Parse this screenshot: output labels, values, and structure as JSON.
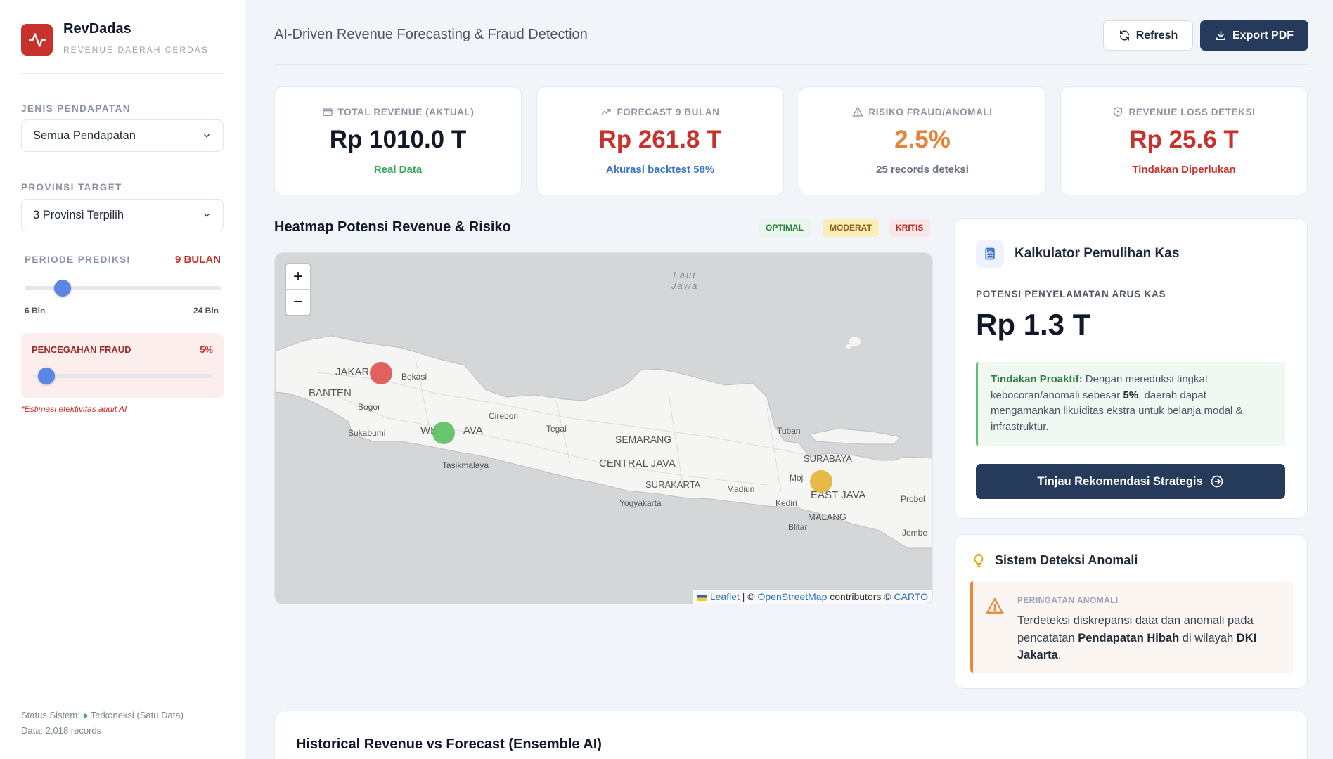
{
  "brand": {
    "title": "RevDadas",
    "subtitle": "REVENUE DAERAH CERDAS"
  },
  "sidebar": {
    "jenis_label": "JENIS PENDAPATAN",
    "jenis_value": "Semua Pendapatan",
    "provinsi_label": "PROVINSI TARGET",
    "provinsi_value": "3 Provinsi Terpilih",
    "periode_label": "PERIODE PREDIKSI",
    "periode_value": "9 BULAN",
    "periode_value_num": 9,
    "periode_min_label": "6 Bln",
    "periode_max_label": "24 Bln",
    "fraud_label": "PENCEGAHAN FRAUD",
    "fraud_value": "5%",
    "fraud_level": 0.05,
    "fraud_note": "*Estimasi efektivitas audit AI",
    "status_prefix": "Status Sistem:",
    "status_text": "Terkoneksi (Satu Data)",
    "data_text": "Data: 2,018 records"
  },
  "header": {
    "title": "AI-Driven Revenue Forecasting & Fraud Detection",
    "refresh_label": "Refresh",
    "export_label": "Export PDF"
  },
  "kpis": [
    {
      "label": "TOTAL REVENUE (AKTUAL)",
      "value": "Rp 1010.0 T",
      "note": "Real Data",
      "icon": "wallet-icon"
    },
    {
      "label": "FORECAST 9 BULAN",
      "value": "Rp 261.8 T",
      "note": "Akurasi backtest 58%",
      "icon": "trending-up-icon"
    },
    {
      "label": "RISIKO FRAUD/ANOMALI",
      "value": "2.5%",
      "note": "25 records deteksi",
      "icon": "warning-icon"
    },
    {
      "label": "REVENUE LOSS DETEKSI",
      "value": "Rp 25.6 T",
      "note": "Tindakan Diperlukan",
      "icon": "shield-icon"
    }
  ],
  "map": {
    "title": "Heatmap Potensi Revenue & Risiko",
    "legend": [
      "OPTIMAL",
      "MODERAT",
      "KRITIS"
    ],
    "labels": {
      "laut": "Laut",
      "jawa": "Jawa",
      "jakarta": "JAKAR",
      "bekasi": "Bekasi",
      "banten": "BANTEN",
      "bogor": "Bogor",
      "sukabumi": "Sukabumi",
      "west_java_a": "WE",
      "west_java_b": "AVA",
      "cirebon": "Cirebon",
      "tegal": "Tegal",
      "tasikmalaya": "Tasikmalaya",
      "semarang": "SEMARANG",
      "central_java": "CENTRAL JAVA",
      "surakarta": "SURAKARTA",
      "yogyakarta": "Yogyakarta",
      "madiun": "Madiun",
      "tuban": "Tuban",
      "surabaya": "SURABAYA",
      "mojo": "Moj",
      "east_java": "EAST JAVA",
      "kediri": "Kediri",
      "malang": "MALANG",
      "blitar": "Blitar",
      "probolinggo": "Probol",
      "jember": "Jembe"
    },
    "zoom_in": "+",
    "zoom_out": "−",
    "attribution": {
      "leaflet": "Leaflet",
      "sep1": " | © ",
      "osm": "OpenStreetMap",
      "contrib": " contributors © ",
      "carto": "CARTO"
    },
    "colors": {
      "kritis": "#e05252",
      "optimal": "#5cbf62",
      "moderat": "#e6b33a"
    }
  },
  "calculator": {
    "title": "Kalkulator Pemulihan Kas",
    "label": "POTENSI PENYELAMATAN ARUS KAS",
    "value": "Rp 1.3 T",
    "proaktif_title": "Tindakan Proaktif:",
    "proaktif_text1": " Dengan mereduksi tingkat kebocoran/anomali sebesar ",
    "proaktif_bold": "5%",
    "proaktif_text2": ", daerah dapat mengamankan likuiditas ekstra untuk belanja modal & infrastruktur.",
    "button_label": "Tinjau Rekomendasi Strategis"
  },
  "anomali": {
    "title": "Sistem Deteksi Anomali",
    "label": "PERINGATAN ANOMALI",
    "text1": "Terdeteksi diskrepansi data dan anomali pada pencatatan ",
    "bold1": "Pendapatan Hibah",
    "text2": " di wilayah ",
    "bold2": "DKI Jakarta",
    "text3": "."
  },
  "history": {
    "title": "Historical Revenue vs Forecast (Ensemble AI)"
  }
}
